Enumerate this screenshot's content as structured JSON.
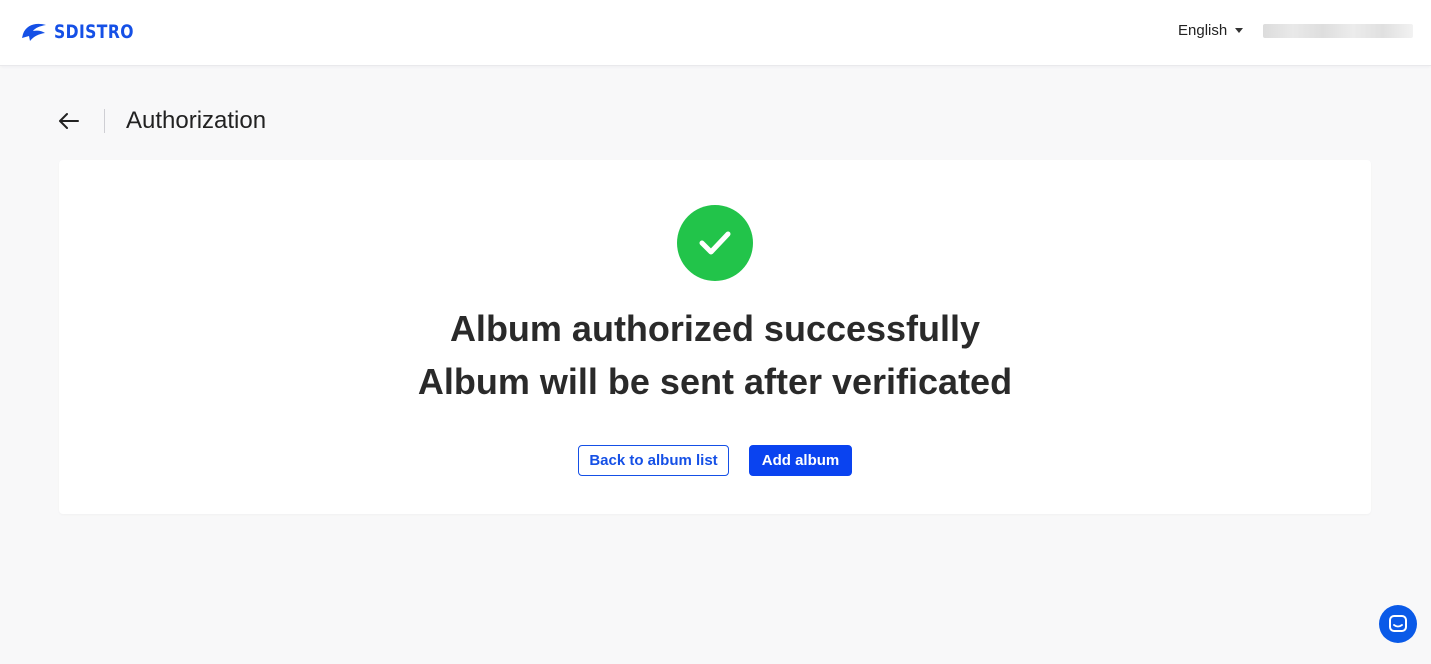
{
  "brand": {
    "name": "SDISTRO",
    "color": "#1550e6"
  },
  "header": {
    "language": "English"
  },
  "page": {
    "title": "Authorization"
  },
  "result": {
    "status": "success",
    "line1": "Album authorized successfully",
    "line2": "Album will be sent after verificated"
  },
  "actions": {
    "back_label": "Back to album list",
    "add_label": "Add album"
  },
  "icons": {
    "logo": "sdistro-logo-icon",
    "language_dropdown": "caret-down-icon",
    "back": "arrow-left-icon",
    "success": "check-circle-icon",
    "chat": "chat-bubble-icon"
  },
  "colors": {
    "success": "#22c44a",
    "primary": "#0a43f0",
    "background": "#f8f8f9"
  }
}
